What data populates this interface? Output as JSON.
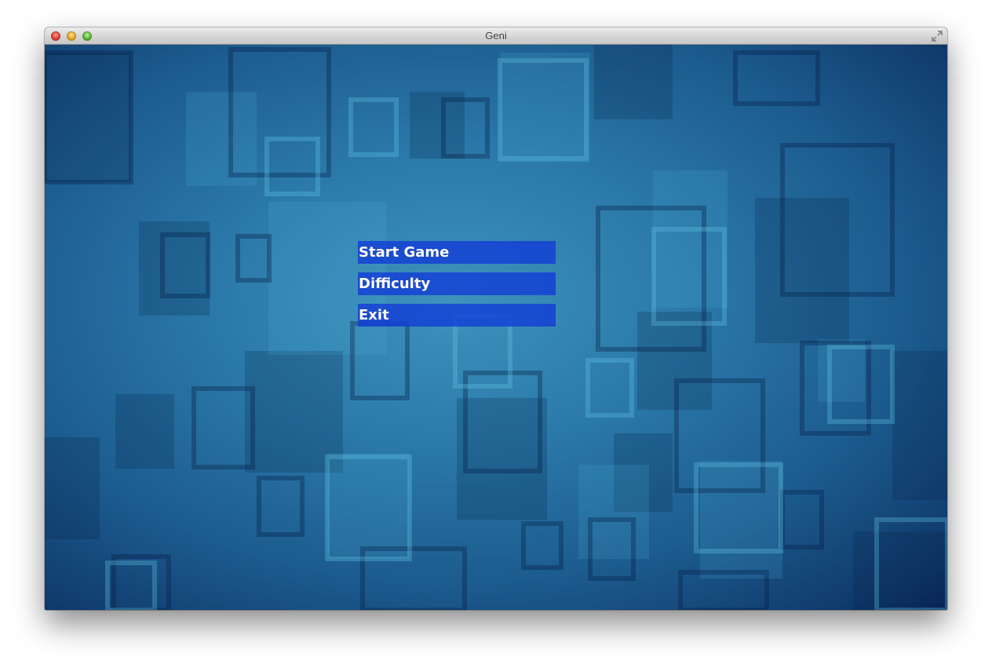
{
  "window": {
    "title": "Geni"
  },
  "menu": {
    "items": [
      {
        "label": "Start Game"
      },
      {
        "label": "Difficulty"
      },
      {
        "label": "Exit"
      }
    ]
  },
  "colors": {
    "background": "#2a78a8",
    "button": "#143ed6",
    "button_text": "#ffffff"
  },
  "icons": {
    "close": "close-icon",
    "minimize": "minimize-icon",
    "zoom": "zoom-icon",
    "fullscreen": "fullscreen-icon"
  }
}
